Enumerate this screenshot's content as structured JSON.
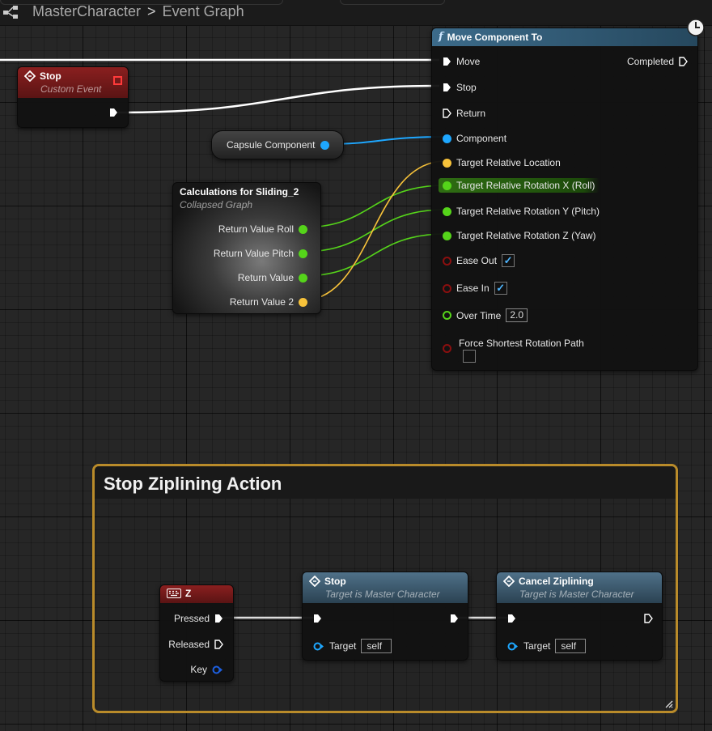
{
  "header": {
    "crumbs": [
      "MasterCharacter",
      "Event Graph"
    ],
    "separator": ">"
  },
  "stop_event": {
    "title": "Stop",
    "subtitle": "Custom Event"
  },
  "capsule": {
    "label": "Capsule Component"
  },
  "calc_node": {
    "title": "Calculations for Sliding_2",
    "subtitle": "Collapsed Graph",
    "outputs": [
      "Return Value Roll",
      "Return Value Pitch",
      "Return Value",
      "Return Value 2"
    ]
  },
  "move_node": {
    "title": "Move Component To",
    "fn_glyph": "f",
    "inputs": {
      "move": "Move",
      "stop": "Stop",
      "return": "Return",
      "component": "Component",
      "location": "Target Relative Location",
      "rot_x": "Target Relative Rotation X (Roll)",
      "rot_y": "Target Relative Rotation Y (Pitch)",
      "rot_z": "Target Relative Rotation Z (Yaw)",
      "ease_out": "Ease Out",
      "ease_in": "Ease In",
      "over_time": "Over Time",
      "force_shortest": "Force Shortest Rotation Path"
    },
    "completed": "Completed",
    "over_time_value": "2.0",
    "ease_out_checked": true,
    "ease_in_checked": true,
    "force_shortest_checked": false
  },
  "comment": {
    "title": "Stop Ziplining Action"
  },
  "key_node": {
    "title": "Z",
    "pressed": "Pressed",
    "released": "Released",
    "key": "Key"
  },
  "stop_call": {
    "title": "Stop",
    "subtitle": "Target is Master Character",
    "target_label": "Target",
    "target_value": "self"
  },
  "cancel_call": {
    "title": "Cancel Ziplining",
    "subtitle": "Target is Master Character",
    "target_label": "Target",
    "target_value": "self"
  },
  "colors": {
    "exec": "#ffffff",
    "object": "#1ea7ff",
    "vector": "#f7c23a",
    "float": "#55d41a",
    "bool": "#8b0f0f",
    "comment_border": "#b98b2a"
  }
}
